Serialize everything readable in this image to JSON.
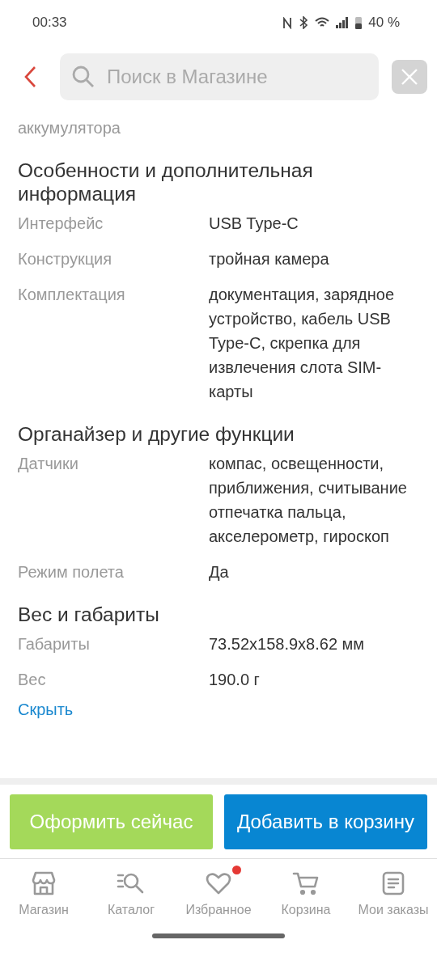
{
  "status_bar": {
    "time": "00:33",
    "battery": "40 %"
  },
  "search": {
    "placeholder": "Поиск в Магазине"
  },
  "sections": [
    {
      "rows": [
        {
          "label": "аккумулятора"
        }
      ]
    },
    {
      "title": "Особенности и дополнительная информация",
      "rows": [
        {
          "label": "Интерфейс",
          "value": "USB Type-C"
        },
        {
          "label": "Конструкция",
          "value": "тройная камера"
        },
        {
          "label": "Комплектация",
          "value": "документация, зарядное устройство, кабель USB Type-C, скрепка для извлечения слота SIM-карты"
        }
      ]
    },
    {
      "title": "Органайзер и другие функции",
      "rows": [
        {
          "label": "Датчики",
          "value": "компас, освещенности, приближения, считывание отпечатка пальца, акселерометр, гироскоп"
        },
        {
          "label": "Режим полета",
          "value": "Да"
        }
      ]
    },
    {
      "title": "Вес и габариты",
      "rows": [
        {
          "label": "Габариты",
          "value": "73.52x158.9x8.62 мм"
        },
        {
          "label": "Вес",
          "value": "190.0 г"
        }
      ]
    }
  ],
  "hide_link": "Скрыть",
  "buttons": [
    {
      "label": "Оформить сейчас",
      "kind": "buy"
    },
    {
      "label": "Добавить в корзину",
      "kind": "cart"
    }
  ],
  "nav": [
    {
      "label": "Магазин",
      "kind": "store",
      "badge": false
    },
    {
      "label": "Каталог",
      "kind": "catalog",
      "badge": false
    },
    {
      "label": "Избранное",
      "kind": "favorites",
      "badge": true
    },
    {
      "label": "Корзина",
      "kind": "cart",
      "badge": false
    },
    {
      "label": "Мои заказы",
      "kind": "orders",
      "badge": false
    }
  ]
}
